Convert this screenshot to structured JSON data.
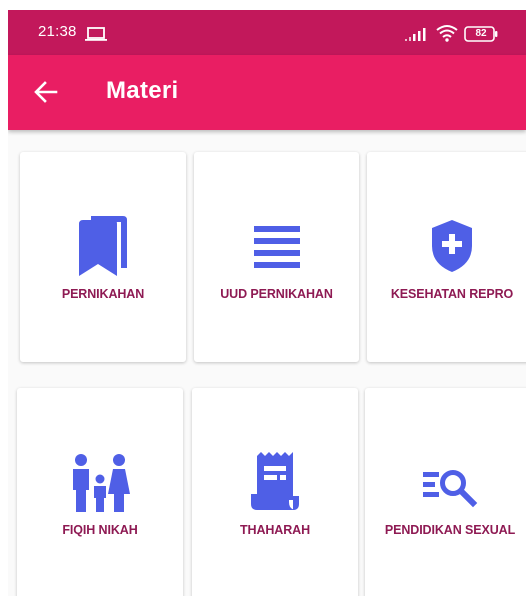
{
  "status_bar": {
    "time": "21:38",
    "battery": "82",
    "icons": [
      "laptop-icon",
      "signal-icon",
      "wifi-icon",
      "battery-icon"
    ]
  },
  "app_bar": {
    "back_icon": "arrow-left-icon",
    "title": "Materi"
  },
  "colors": {
    "status_bar": "#c2185b",
    "app_bar": "#e91e63",
    "icon_blue": "#4f5fe6",
    "label": "#8e1a53"
  },
  "menu": {
    "items": [
      {
        "label": "PERNIKAHAN",
        "icon": "book-icon"
      },
      {
        "label": "UUD PERNIKAHAN",
        "icon": "list-icon"
      },
      {
        "label": "KESEHATAN REPRO",
        "icon": "shield-plus-icon"
      },
      {
        "label": "FIQIH NIKAH",
        "icon": "family-icon"
      },
      {
        "label": "THAHARAH",
        "icon": "receipt-icon"
      },
      {
        "label": "PENDIDIKAN SEXUAL",
        "icon": "search-list-icon"
      }
    ]
  }
}
